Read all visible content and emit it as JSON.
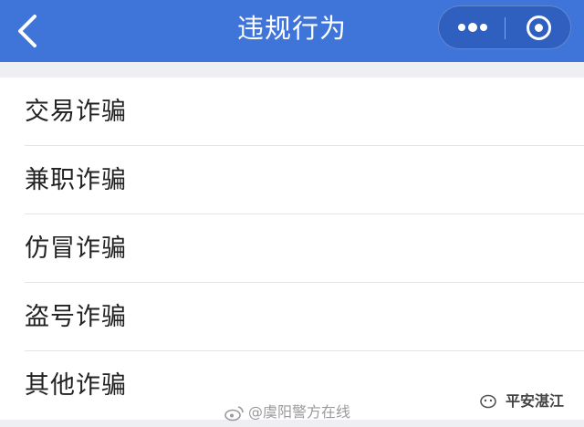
{
  "header": {
    "title": "违规行为",
    "back_icon": "chevron-left-icon",
    "more_icon": "more-dots-icon",
    "close_icon": "target-circle-icon",
    "background_color": "#3f74d8"
  },
  "menu": {
    "items": [
      {
        "label": "交易诈骗"
      },
      {
        "label": "兼职诈骗"
      },
      {
        "label": "仿冒诈骗"
      },
      {
        "label": "盗号诈骗"
      },
      {
        "label": "其他诈骗"
      }
    ]
  },
  "watermarks": {
    "weibo": "@虞阳警方在线",
    "account": "平安湛江"
  }
}
